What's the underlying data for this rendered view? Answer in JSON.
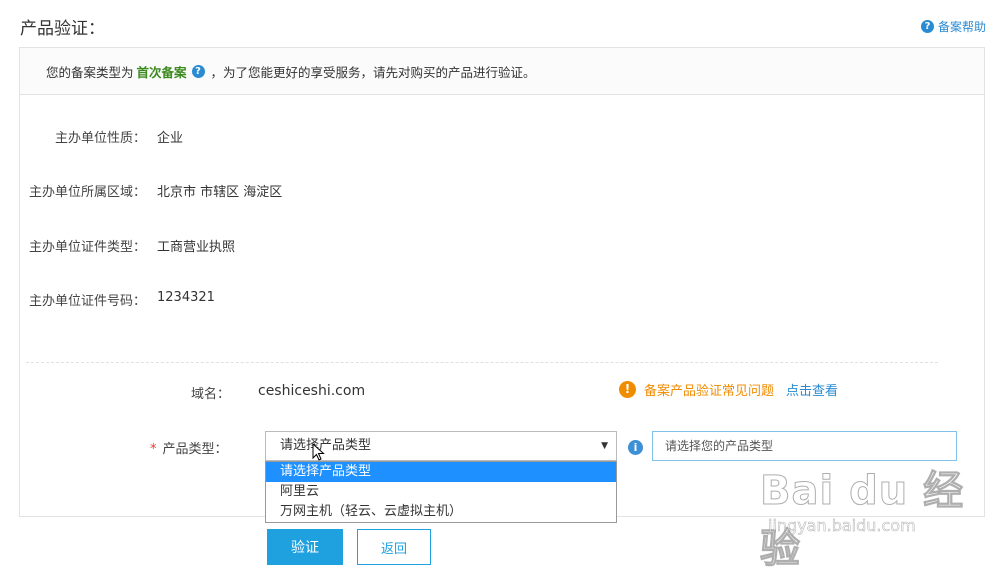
{
  "header": {
    "title": "产品验证：",
    "help_label": "备案帮助"
  },
  "notice": {
    "prefix": "您的备案类型为",
    "type": "首次备案",
    "suffix": "，为了您能更好的享受服务，请先对购买的产品进行验证。"
  },
  "fields": [
    {
      "label": "主办单位性质：",
      "value": "企业"
    },
    {
      "label": "主办单位所属区域：",
      "value": "北京市 市辖区 海淀区"
    },
    {
      "label": "主办单位证件类型：",
      "value": "工商营业执照"
    },
    {
      "label": "主办单位证件号码：",
      "value": "1234321"
    }
  ],
  "domain": {
    "label": "域名：",
    "value": "ceshiceshi.com"
  },
  "faq": {
    "text": "备案产品验证常见问题",
    "link": "点击查看"
  },
  "product_type": {
    "required_mark": "*",
    "label": "产品类型：",
    "selected": "请选择产品类型",
    "options": [
      "请选择产品类型",
      "阿里云",
      "万网主机（轻云、云虚拟主机）"
    ],
    "hint": "请选择您的产品类型"
  },
  "buttons": {
    "verify": "验证",
    "back": "返回"
  },
  "watermark": {
    "main": "Bai du 经验",
    "sub": "jingyan.baidu.com"
  },
  "colors": {
    "accent": "#1fa0df",
    "notice_type": "#3d8a1f",
    "faq_orange": "#f08c00",
    "selected_option": "#1e90ff"
  }
}
